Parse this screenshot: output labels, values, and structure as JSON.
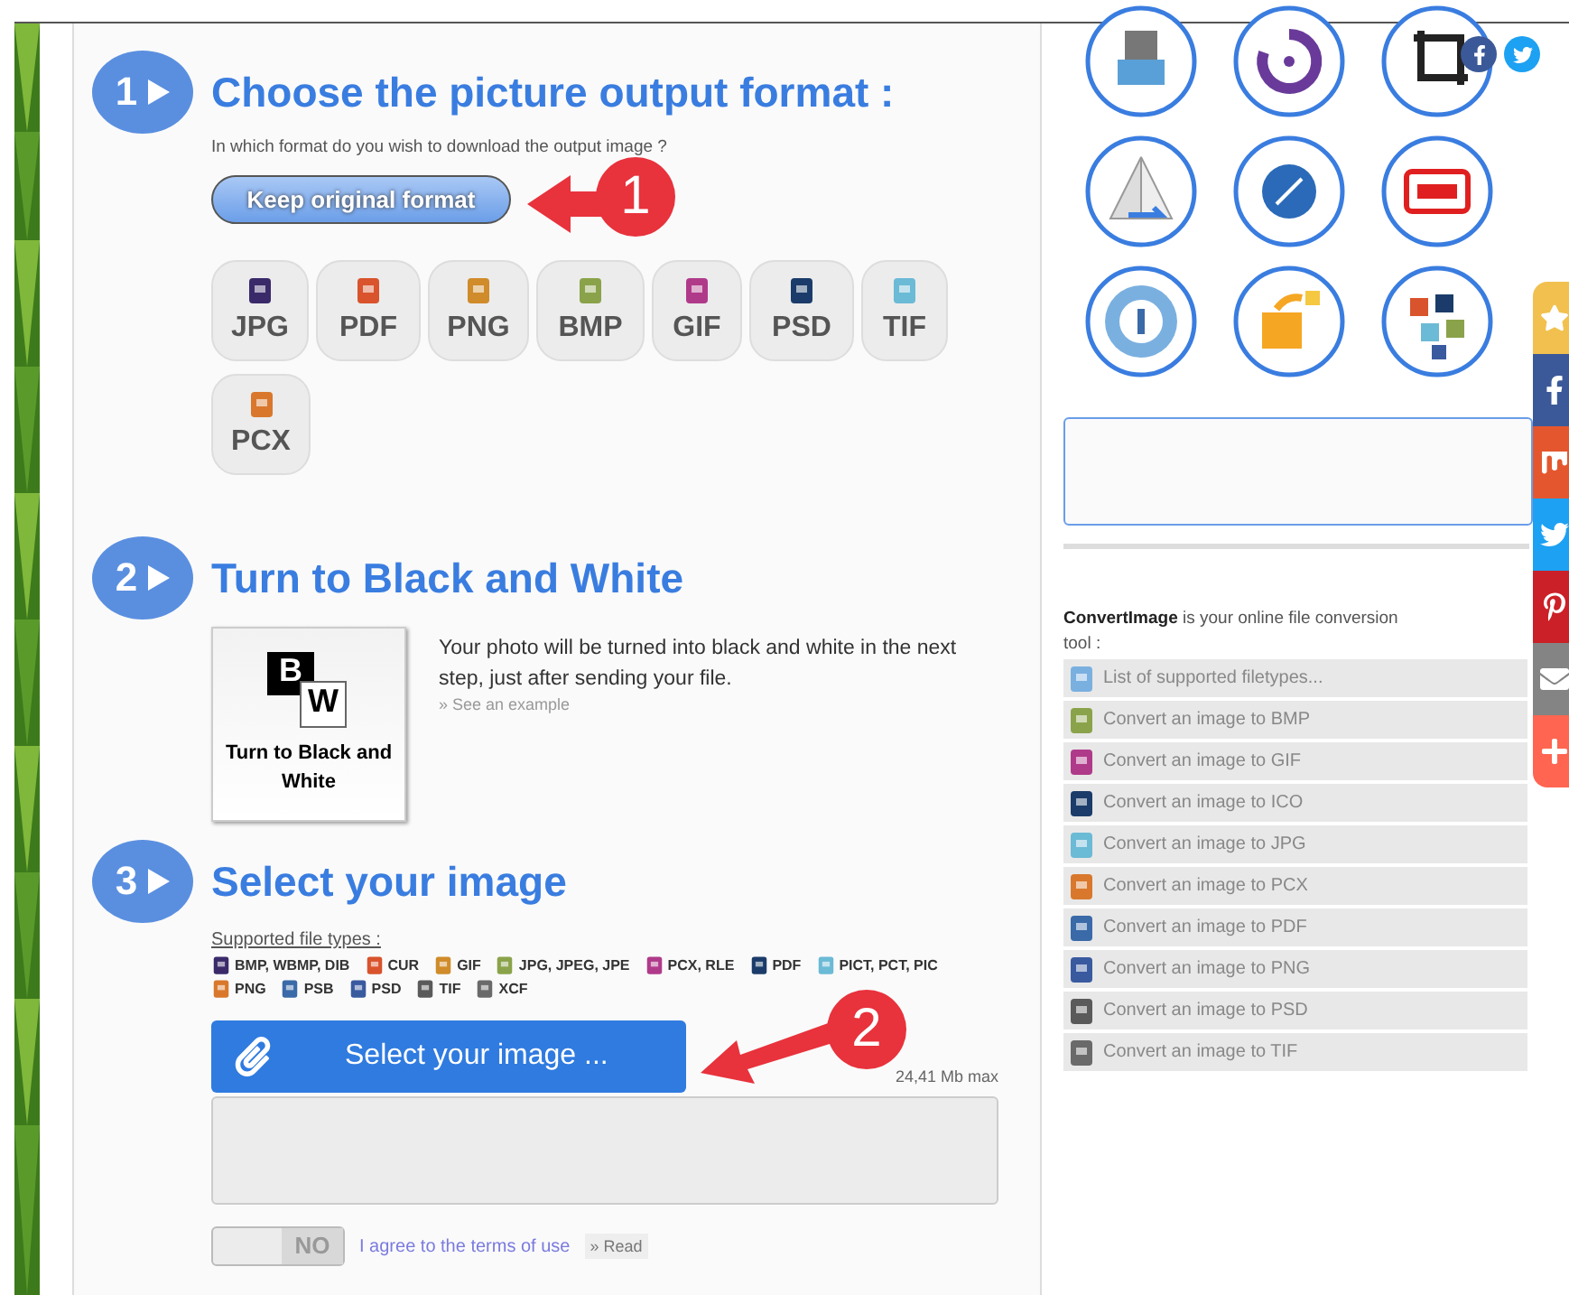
{
  "format_step": {
    "number": "1",
    "title": "Choose the picture output format :",
    "subtitle": "In which format do you wish to download the output image ?",
    "keep_button": "Keep original format",
    "formats": [
      {
        "label": "JPG"
      },
      {
        "label": "PDF"
      },
      {
        "label": "PNG"
      },
      {
        "label": "BMP"
      },
      {
        "label": "GIF"
      },
      {
        "label": "PSD"
      },
      {
        "label": "TIF"
      },
      {
        "label": "PCX"
      }
    ]
  },
  "bw_step": {
    "number": "2",
    "title": "Turn to Black and White",
    "card_letters": [
      "B",
      "W"
    ],
    "card_label": "Turn to Black and White",
    "description": "Your photo will be turned into black and white in the next step, just after sending your file.",
    "example_link": "» See an example"
  },
  "select_step": {
    "number": "3",
    "title": "Select your image",
    "supported_label": "Supported file types :",
    "file_types": [
      "BMP, WBMP, DIB",
      "CUR",
      "GIF",
      "JPG, JPEG, JPE",
      "PCX, RLE",
      "PDF",
      "PICT, PCT, PIC",
      "PNG",
      "PSB",
      "PSD",
      "TIF",
      "XCF"
    ],
    "select_button": "Select your image ...",
    "max_size": "24,41 Mb max",
    "toggle": {
      "label": "NO",
      "on": false
    },
    "terms_link": "I agree to the terms of use",
    "read_button": "» Read"
  },
  "social_links": [
    {
      "kind": "facebook",
      "color": "#3b5998"
    },
    {
      "kind": "twitter",
      "color": "#1da1f2"
    }
  ],
  "sidebar": {
    "intro": "**ConvertImage** is your online file conversion tool :",
    "links": [
      {
        "label": "List of supported filetypes..."
      },
      {
        "label": "Convert an image to BMP"
      },
      {
        "label": "Convert an image to GIF"
      },
      {
        "label": "Convert an image to ICO"
      },
      {
        "label": "Convert an image to JPG"
      },
      {
        "label": "Convert an image to PCX"
      },
      {
        "label": "Convert an image to PDF"
      },
      {
        "label": "Convert an image to PNG"
      },
      {
        "label": "Convert an image to PSD"
      },
      {
        "label": "Convert an image to TIF"
      }
    ]
  },
  "share_bar": [
    {
      "kind": "star",
      "color": "#f1c04f"
    },
    {
      "kind": "facebook",
      "color": "#3b5998"
    },
    {
      "kind": "mix",
      "color": "#e4572e"
    },
    {
      "kind": "twitter",
      "color": "#1da1f2"
    },
    {
      "kind": "pinterest",
      "color": "#cb2027"
    },
    {
      "kind": "mail",
      "color": "#848484"
    },
    {
      "kind": "plus",
      "color": "#ff6550"
    }
  ],
  "callouts": [
    {
      "label": "1"
    },
    {
      "label": "2"
    }
  ]
}
